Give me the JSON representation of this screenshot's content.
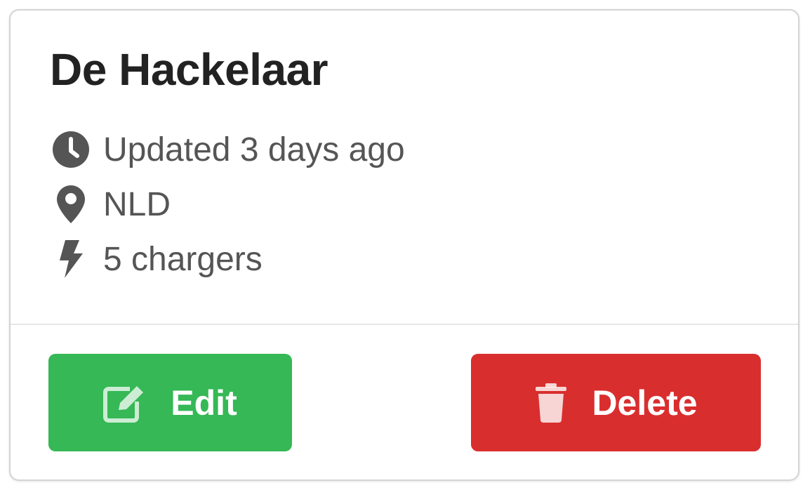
{
  "card": {
    "title": "De Hackelaar",
    "meta": {
      "updated": {
        "icon": "clock-icon",
        "text": "Updated 3 days ago"
      },
      "country": {
        "icon": "map-marker-icon",
        "text": "NLD"
      },
      "chargers": {
        "icon": "bolt-icon",
        "text": "5 chargers"
      }
    },
    "actions": {
      "edit": {
        "icon": "edit-icon",
        "label": "Edit",
        "color": "#35b855"
      },
      "delete": {
        "icon": "trash-icon",
        "label": "Delete",
        "color": "#d92e2e"
      }
    }
  },
  "colors": {
    "title": "#222222",
    "meta_text": "#555555",
    "card_border": "#d4d4d5"
  }
}
